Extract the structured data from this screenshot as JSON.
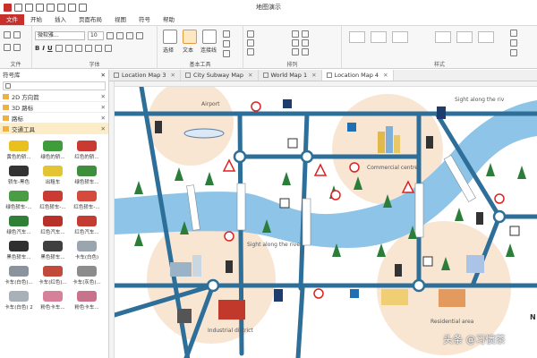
{
  "app": {
    "title": "地图演示"
  },
  "ribbon": {
    "tabs": [
      "文件",
      "开始",
      "插入",
      "页面布局",
      "视图",
      "符号",
      "帮助"
    ],
    "active_tab": "文件",
    "font_name": "微软雅...",
    "font_size": "10",
    "groups": {
      "clipboard": "文件",
      "font": "字体",
      "tools": "基本工具",
      "arrange": "排列",
      "style": "样式"
    },
    "tool_labels": {
      "select": "选择",
      "text": "文本",
      "connector": "连接线"
    }
  },
  "library": {
    "title": "符号库",
    "categories": [
      {
        "label": "2D 方向箭",
        "active": false
      },
      {
        "label": "3D 路标",
        "active": false
      },
      {
        "label": "路标",
        "active": false
      },
      {
        "label": "交通工具",
        "active": true
      }
    ],
    "items": [
      {
        "label": "黄色的轿...",
        "color": "#e8c020"
      },
      {
        "label": "绿色的轿...",
        "color": "#3f9c3a"
      },
      {
        "label": "红色的轿...",
        "color": "#c83a32"
      },
      {
        "label": "轿车-黑色",
        "color": "#333333"
      },
      {
        "label": "出租车",
        "color": "#e3c432"
      },
      {
        "label": "绿色轿车...",
        "color": "#3d8f3c"
      },
      {
        "label": "绿色轿车-...",
        "color": "#4a9d44"
      },
      {
        "label": "红色轿车-...",
        "color": "#cc3b33"
      },
      {
        "label": "红色轿车-...",
        "color": "#d44a3c"
      },
      {
        "label": "绿色汽车...",
        "color": "#2f7f34"
      },
      {
        "label": "红色汽车...",
        "color": "#b73029"
      },
      {
        "label": "红色汽车...",
        "color": "#c33b32"
      },
      {
        "label": "黑色轿车...",
        "color": "#303030"
      },
      {
        "label": "黑色轿车...",
        "color": "#404040"
      },
      {
        "label": "卡车(白色)",
        "color": "#9aa5b0"
      },
      {
        "label": "卡车(白色)...",
        "color": "#8a949e"
      },
      {
        "label": "卡车(红色)...",
        "color": "#c24a3a"
      },
      {
        "label": "卡车(灰色)...",
        "color": "#8c8c8c"
      },
      {
        "label": "卡车(白色) 2",
        "color": "#a8b0b8"
      },
      {
        "label": "粉色卡车...",
        "color": "#d6809a"
      },
      {
        "label": "粉色卡车...",
        "color": "#c9728c"
      }
    ]
  },
  "doc_tabs": [
    {
      "label": "Location Map 3",
      "active": false
    },
    {
      "label": "City Subway Map",
      "active": false
    },
    {
      "label": "World Map 1",
      "active": false
    },
    {
      "label": "Location Map 4",
      "active": true
    }
  ],
  "map": {
    "labels": {
      "airport": "Airport",
      "sight_top": "Sight along the riv",
      "commercial": "Commercial centre",
      "sight_mid": "Sight along the river",
      "industrial": "Industrial district",
      "residential": "Residential area",
      "north": "N"
    },
    "colors": {
      "road": "#2e6f99",
      "river": "#8ec4e8",
      "zone": "#f8e6d2"
    }
  },
  "watermark": "头条 @习惯茶"
}
